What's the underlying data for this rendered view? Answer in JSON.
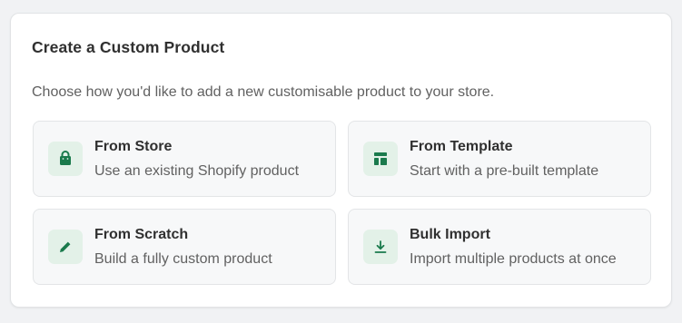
{
  "card": {
    "title": "Create a Custom Product",
    "subtitle": "Choose how you'd like to add a new customisable product to your store."
  },
  "options": [
    {
      "title": "From Store",
      "description": "Use an existing Shopify product",
      "icon": "shopping-bag-icon"
    },
    {
      "title": "From Template",
      "description": "Start with a pre-built template",
      "icon": "layout-template-icon"
    },
    {
      "title": "From Scratch",
      "description": "Build a fully custom product",
      "icon": "pencil-icon"
    },
    {
      "title": "Bulk Import",
      "description": "Import multiple products at once",
      "icon": "download-icon"
    }
  ],
  "colors": {
    "accent": "#1a7a4c",
    "icon_background": "#e3f1e8",
    "option_background": "#f7f8f9",
    "page_background": "#f1f2f4"
  }
}
